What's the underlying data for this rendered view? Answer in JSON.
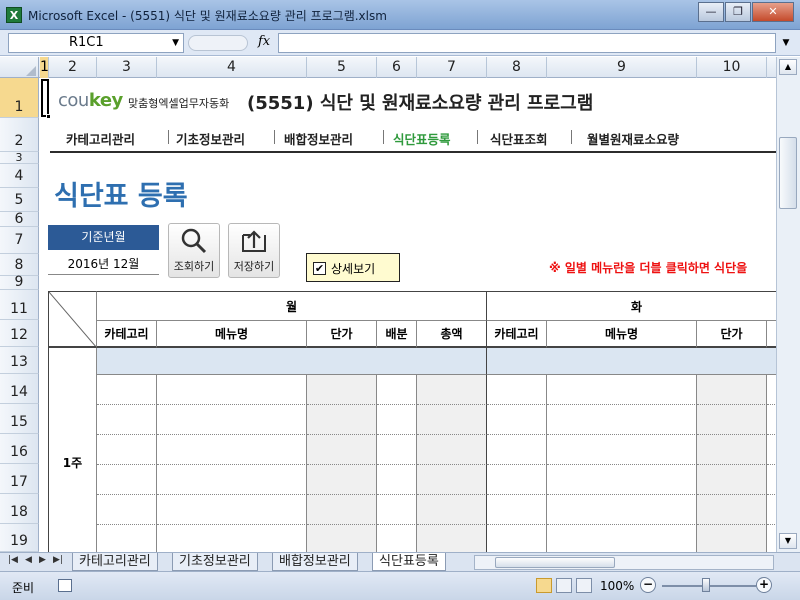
{
  "window": {
    "title": "Microsoft Excel - (5551) 식단 및 원재료소요량 관리 프로그램.xlsm",
    "app_icon_letter": "X",
    "minimize": "—",
    "restore": "❐",
    "close": "✕"
  },
  "formula_bar": {
    "name_box": "R1C1",
    "fx": "fx",
    "value": ""
  },
  "columns": [
    "1",
    "2",
    "3",
    "4",
    "5",
    "6",
    "7",
    "8",
    "9",
    "10"
  ],
  "rows": [
    "1",
    "2",
    "3",
    "4",
    "5",
    "6",
    "7",
    "8",
    "9",
    "11",
    "12",
    "13",
    "14",
    "15",
    "16",
    "17",
    "18",
    "19"
  ],
  "header": {
    "logo_main": "cou",
    "logo_key": "key",
    "logo_sub": "맞춤형엑셀업무자동화",
    "title": "(5551) 식단 및 원재료소요량 관리 프로그램"
  },
  "nav": {
    "items": [
      "카테고리관리",
      "기초정보관리",
      "배합정보관리",
      "식단표등록",
      "식단표조회",
      "월별원재료소요량"
    ],
    "active_index": 3
  },
  "page": {
    "heading": "식단표 등록",
    "base_label": "기준년월",
    "base_value": "2016년 12월",
    "search_button": "조회하기",
    "save_button": "저장하기",
    "detail_label": "상세보기",
    "detail_checked": "✔",
    "notice": "※ 일별 메뉴란을 더블 클릭하면 식단을"
  },
  "table": {
    "day_mon": "월",
    "day_tue": "화",
    "col_headers_mon": [
      "카테고리",
      "메뉴명",
      "단가",
      "배분",
      "총액"
    ],
    "col_headers_tue": [
      "카테고리",
      "메뉴명",
      "단가"
    ],
    "week_label": "1주"
  },
  "sheet_tabs": [
    "카테고리관리",
    "기초정보관리",
    "배합정보관리",
    "식단표등록"
  ],
  "active_tab": "식단표등록",
  "status": {
    "ready": "준비",
    "zoom": "100%",
    "zoom_minus": "−",
    "zoom_plus": "+"
  }
}
